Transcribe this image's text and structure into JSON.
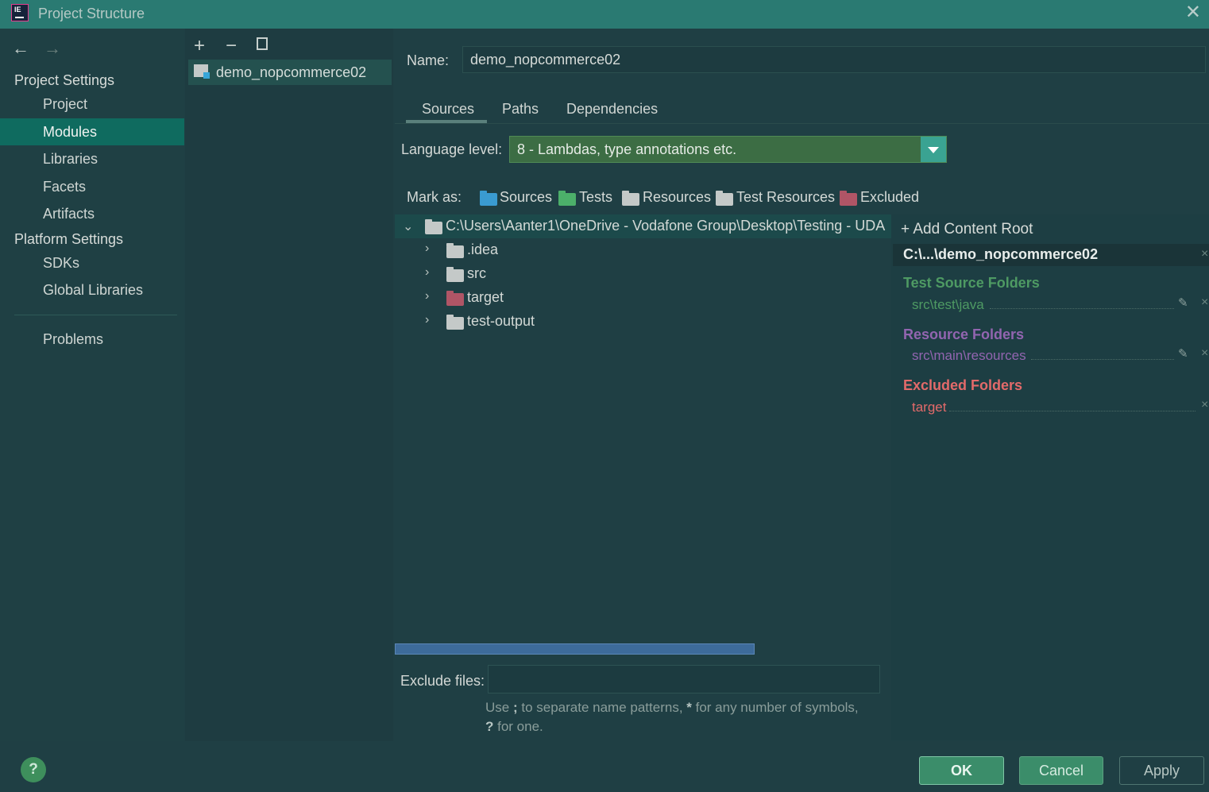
{
  "window": {
    "title": "Project Structure",
    "close_icon": "close-icon"
  },
  "nav": {
    "project_settings_header": "Project Settings",
    "project_items": [
      "Project",
      "Modules",
      "Libraries",
      "Facets",
      "Artifacts"
    ],
    "platform_settings_header": "Platform Settings",
    "platform_items": [
      "SDKs",
      "Global Libraries"
    ],
    "problems": "Problems",
    "selected": "Modules"
  },
  "module_list": {
    "items": [
      "demo_nopcommerce02"
    ]
  },
  "module": {
    "name_label": "Name:",
    "name_value": "demo_nopcommerce02",
    "tabs": [
      "Sources",
      "Paths",
      "Dependencies"
    ],
    "active_tab": "Sources",
    "language_level_label": "Language level:",
    "language_level_value": "8 - Lambdas, type annotations etc.",
    "mark_as_label": "Mark as:",
    "mark_as": [
      "Sources",
      "Tests",
      "Resources",
      "Test Resources",
      "Excluded"
    ],
    "tree": {
      "root": "C:\\Users\\Aanter1\\OneDrive - Vodafone Group\\Desktop\\Testing - UDA",
      "children": [
        ".idea",
        "src",
        "target",
        "test-output"
      ]
    },
    "exclude_files_label": "Exclude files:",
    "hint_part1": "Use ",
    "hint_semicolon": ";",
    "hint_part2": " to separate name patterns, ",
    "hint_star": "*",
    "hint_part3": " for any number of symbols,",
    "hint_question": "?",
    "hint_part4": " for one."
  },
  "content_root": {
    "add_label": "Add Content Root",
    "path": "C:\\...\\demo_nopcommerce02",
    "test_source_header": "Test Source Folders",
    "test_source_item": "src\\test\\java",
    "resource_header": "Resource Folders",
    "resource_item": "src\\main\\resources",
    "excluded_header": "Excluded Folders",
    "excluded_item": "target"
  },
  "buttons": {
    "ok": "OK",
    "cancel": "Cancel",
    "apply": "Apply",
    "help": "?"
  },
  "colors": {
    "test_source": "#4e9a63",
    "resource": "#9265b0",
    "excluded": "#e36a6a",
    "sources_folder": "#3a9bd1",
    "tests_folder": "#4caf6a",
    "excluded_folder": "#b05566"
  }
}
